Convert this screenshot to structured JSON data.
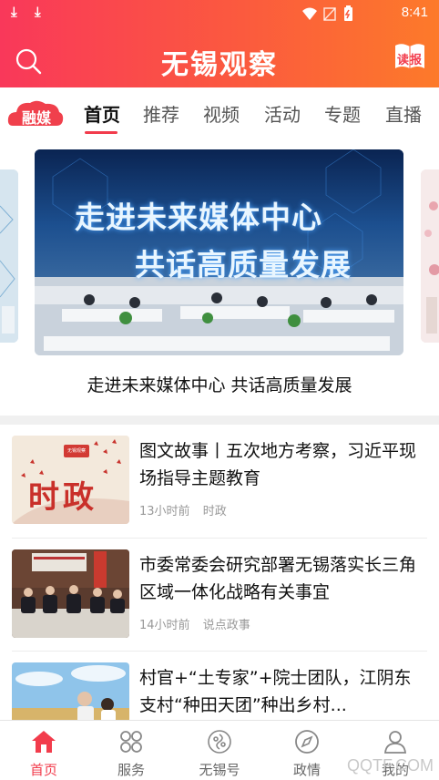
{
  "status_bar": {
    "time": "8:41"
  },
  "header": {
    "title": "无锡观察",
    "read_label": "读报"
  },
  "channel_logo": {
    "text": "融媒"
  },
  "tabs": [
    {
      "label": "首页"
    },
    {
      "label": "推荐"
    },
    {
      "label": "视频"
    },
    {
      "label": "活动"
    },
    {
      "label": "专题"
    },
    {
      "label": "直播"
    }
  ],
  "banner": {
    "line1": "走进未来媒体中心",
    "line2": "共话高质量发展",
    "caption": "走进未来媒体中心 共话高质量发展"
  },
  "news": [
    {
      "title": "图文故事丨五次地方考察，习近平现场指导主题教育",
      "time": "13小时前",
      "source": "时政",
      "thumb_text": "时政",
      "thumb_badge": "无锡观察"
    },
    {
      "title": "市委常委会研究部署无锡落实长三角区域一体化战略有关事宜",
      "time": "14小时前",
      "source": "说点政事"
    },
    {
      "title": "村官+“土专家”+院士团队，江阴东支村“种田天团”种出乡村..."
    }
  ],
  "bottom_nav": [
    {
      "label": "首页",
      "icon": "home-icon"
    },
    {
      "label": "服务",
      "icon": "services-icon"
    },
    {
      "label": "无锡号",
      "icon": "wuxi-account-icon"
    },
    {
      "label": "政情",
      "icon": "compass-icon"
    },
    {
      "label": "我的",
      "icon": "user-icon"
    }
  ],
  "watermark": "QQTF.COM",
  "colors": {
    "accent": "#f23c4c",
    "header_start": "#f9385a",
    "header_end": "#fd7a2a"
  }
}
